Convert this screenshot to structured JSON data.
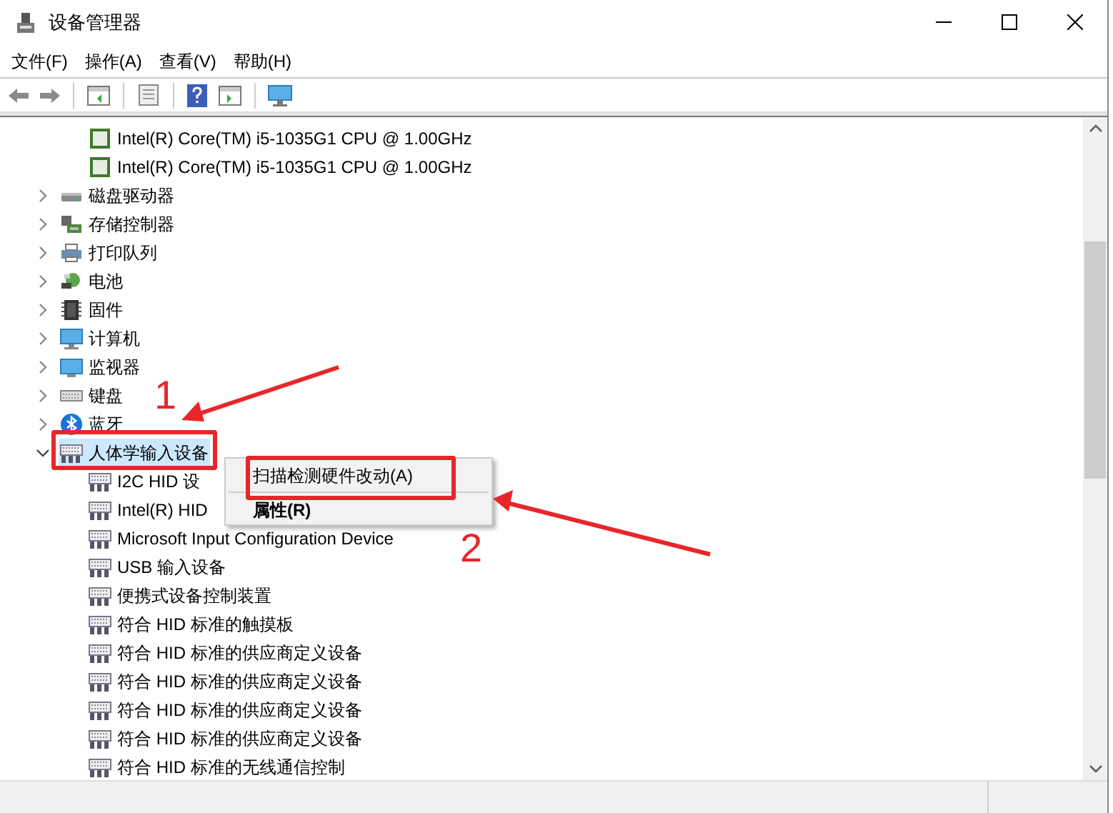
{
  "window": {
    "title": "设备管理器"
  },
  "menu_bar": [
    "文件(F)",
    "操作(A)",
    "查看(V)",
    "帮助(H)"
  ],
  "tree": [
    {
      "kind": "continued",
      "children": [
        {
          "kind": "cpu",
          "label": "Intel(R) Core(TM) i5-1035G1 CPU @ 1.00GHz",
          "selected": false
        },
        {
          "kind": "cpu",
          "label": "Intel(R) Core(TM) i5-1035G1 CPU @ 1.00GHz",
          "selected": false
        }
      ]
    },
    {
      "kind": "disk",
      "label": "磁盘驱动器",
      "expanded": false,
      "selected": false
    },
    {
      "kind": "storage",
      "label": "存储控制器",
      "expanded": false,
      "selected": false
    },
    {
      "kind": "printer",
      "label": "打印队列",
      "expanded": false,
      "selected": false
    },
    {
      "kind": "battery",
      "label": "电池",
      "expanded": false,
      "selected": false
    },
    {
      "kind": "firmware",
      "label": "固件",
      "expanded": false,
      "selected": false
    },
    {
      "kind": "computer",
      "label": "计算机",
      "expanded": false,
      "selected": false
    },
    {
      "kind": "monitor",
      "label": "监视器",
      "expanded": false,
      "selected": false
    },
    {
      "kind": "keyboard",
      "label": "键盘",
      "expanded": false,
      "selected": false
    },
    {
      "kind": "bluetooth",
      "label": "蓝牙",
      "expanded": false,
      "selected": false
    },
    {
      "kind": "hid",
      "label": "人体学输入设备",
      "expanded": true,
      "selected": true,
      "children": [
        {
          "kind": "hid",
          "label": "I2C HID 设",
          "selected": false
        },
        {
          "kind": "hid",
          "label": "Intel(R) HID",
          "selected": false
        },
        {
          "kind": "hid",
          "label": "Microsoft Input Configuration Device",
          "selected": false
        },
        {
          "kind": "hid",
          "label": "USB 输入设备",
          "selected": false
        },
        {
          "kind": "hid",
          "label": "便携式设备控制装置",
          "selected": false
        },
        {
          "kind": "hid",
          "label": "符合 HID 标准的触摸板",
          "selected": false
        },
        {
          "kind": "hid",
          "label": "符合 HID 标准的供应商定义设备",
          "selected": false
        },
        {
          "kind": "hid",
          "label": "符合 HID 标准的供应商定义设备",
          "selected": false
        },
        {
          "kind": "hid",
          "label": "符合 HID 标准的供应商定义设备",
          "selected": false
        },
        {
          "kind": "hid",
          "label": "符合 HID 标准的供应商定义设备",
          "selected": false
        },
        {
          "kind": "hid",
          "label": "符合 HID 标准的无线通信控制",
          "selected": false
        }
      ]
    }
  ],
  "context_menu": [
    {
      "label": "扫描检测硬件改动(A)",
      "default": false
    },
    {
      "label": "属性(R)",
      "default": true
    }
  ],
  "annotations": [
    {
      "number": "1"
    },
    {
      "number": "2"
    }
  ]
}
